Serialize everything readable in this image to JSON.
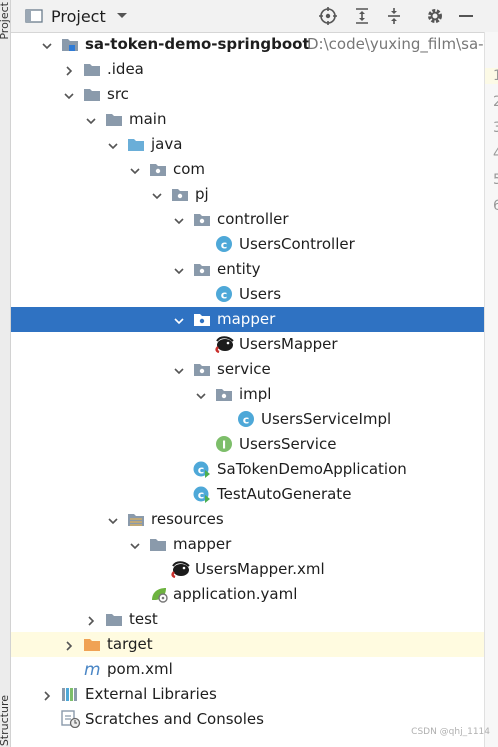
{
  "sidebar": {
    "top_label": "Project",
    "bottom_label": "Structure"
  },
  "toolbar": {
    "title": "Project",
    "icons": [
      "locate-icon",
      "expand-all-icon",
      "collapse-all-icon",
      "settings-icon",
      "minimize-icon"
    ]
  },
  "tree": [
    {
      "label": "sa-token-demo-springboot",
      "path": "D:\\code\\yuxing_film\\sa-toke",
      "icon": "module-folder-icon",
      "expanded": true
    },
    {
      "label": ".idea",
      "icon": "folder-icon",
      "expanded": false
    },
    {
      "label": "src",
      "icon": "folder-icon",
      "expanded": true
    },
    {
      "label": "main",
      "icon": "folder-icon",
      "expanded": true
    },
    {
      "label": "java",
      "icon": "source-folder-icon",
      "expanded": true
    },
    {
      "label": "com",
      "icon": "package-icon",
      "expanded": true
    },
    {
      "label": "pj",
      "icon": "package-icon",
      "expanded": true
    },
    {
      "label": "controller",
      "icon": "package-icon",
      "expanded": true
    },
    {
      "label": "UsersController",
      "icon": "class-icon"
    },
    {
      "label": "entity",
      "icon": "package-icon",
      "expanded": true
    },
    {
      "label": "Users",
      "icon": "class-icon"
    },
    {
      "label": "mapper",
      "icon": "package-icon",
      "expanded": true,
      "selected": true
    },
    {
      "label": "UsersMapper",
      "icon": "mybatis-mapper-icon"
    },
    {
      "label": "service",
      "icon": "package-icon",
      "expanded": true
    },
    {
      "label": "impl",
      "icon": "package-icon",
      "expanded": true
    },
    {
      "label": "UsersServiceImpl",
      "icon": "class-icon"
    },
    {
      "label": "UsersService",
      "icon": "interface-icon"
    },
    {
      "label": "SaTokenDemoApplication",
      "icon": "spring-boot-class-icon"
    },
    {
      "label": "TestAutoGenerate",
      "icon": "runnable-class-icon"
    },
    {
      "label": "resources",
      "icon": "resources-folder-icon",
      "expanded": true
    },
    {
      "label": "mapper",
      "icon": "folder-icon",
      "expanded": true
    },
    {
      "label": "UsersMapper.xml",
      "icon": "mybatis-xml-icon"
    },
    {
      "label": "application.yaml",
      "icon": "spring-config-icon"
    },
    {
      "label": "test",
      "icon": "folder-icon",
      "expanded": false
    },
    {
      "label": "target",
      "icon": "excluded-folder-icon",
      "expanded": false,
      "highlight": true
    },
    {
      "label": "pom.xml",
      "icon": "maven-icon"
    },
    {
      "label": "External Libraries",
      "icon": "libraries-icon",
      "expanded": false
    },
    {
      "label": "Scratches and Consoles",
      "icon": "scratches-icon",
      "expanded": false
    }
  ],
  "gutter": {
    "lines": [
      "1",
      "2",
      "3",
      "4",
      "5",
      "6"
    ]
  },
  "watermark": "CSDN @qhj_1114",
  "colors": {
    "selection": "#2f72c2",
    "folder": "#8a9aab",
    "source_folder": "#6aaed8",
    "excluded": "#f0a254",
    "class": "#4ea8d8",
    "interface": "#7dbe6a",
    "highlight_row": "#fffbe0"
  }
}
